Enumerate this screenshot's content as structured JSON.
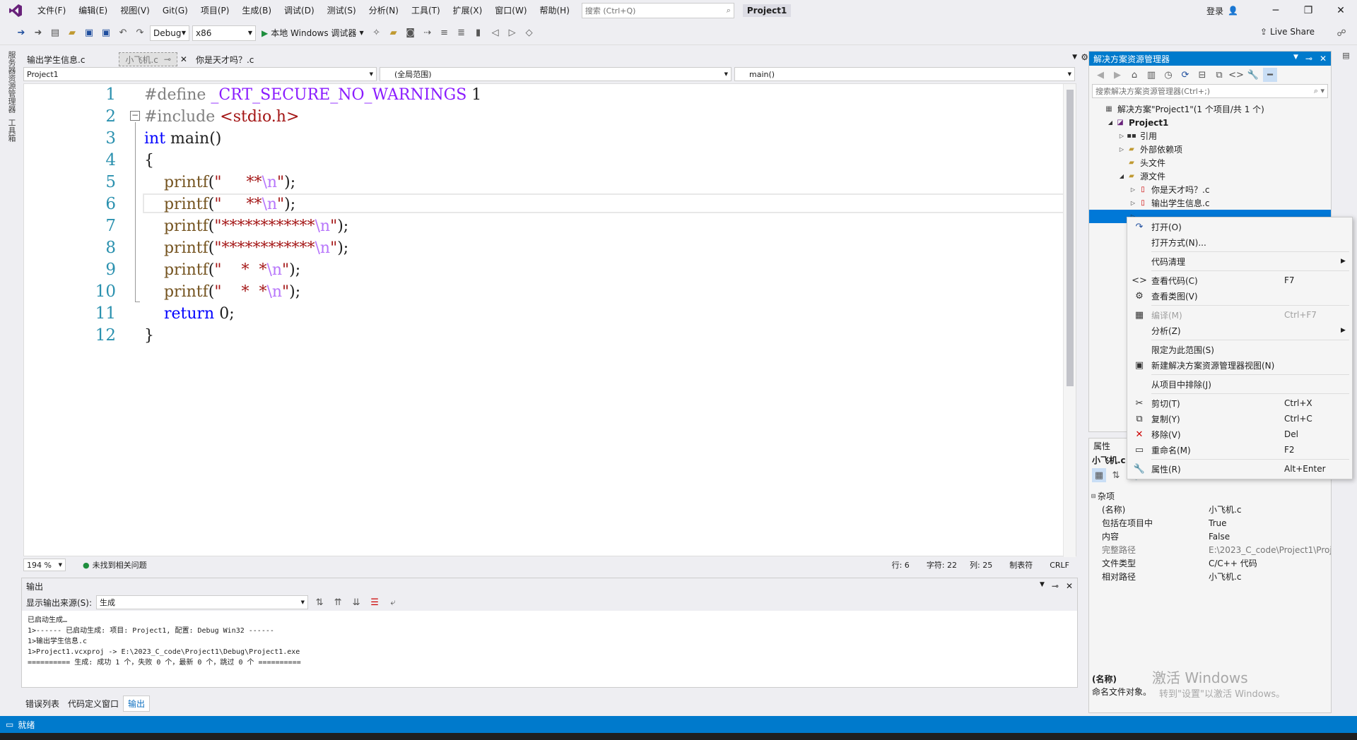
{
  "menubar": {
    "items": [
      "文件(F)",
      "编辑(E)",
      "视图(V)",
      "Git(G)",
      "项目(P)",
      "生成(B)",
      "调试(D)",
      "测试(S)",
      "分析(N)",
      "工具(T)",
      "扩展(X)",
      "窗口(W)",
      "帮助(H)"
    ],
    "search_placeholder": "搜索 (Ctrl+Q)",
    "project_title": "Project1",
    "login": "登录"
  },
  "toolbar": {
    "config": "Debug",
    "platform": "x86",
    "run_label": "本地 Windows 调试器",
    "live_share": "Live Share"
  },
  "left_strip": {
    "labels": [
      "服务器资源管理器",
      "工具箱"
    ]
  },
  "tabs": [
    {
      "label": "输出学生信息.c"
    },
    {
      "label": "小飞机.c"
    },
    {
      "label": "你是天才吗？.c"
    }
  ],
  "navbar": {
    "project": "Project1",
    "scope": "(全局范围)",
    "member": "main()"
  },
  "editor": {
    "line_numbers": [
      "1",
      "2",
      "3",
      "4",
      "5",
      "6",
      "7",
      "8",
      "9",
      "10",
      "11",
      "12"
    ],
    "lines": [
      {
        "a": "#define ",
        "b": "_CRT_SECURE_NO_WARNINGS",
        "c": " 1"
      },
      {
        "a": "#include ",
        "b": "<stdio.h>"
      },
      {
        "a": "int",
        "b": " main()"
      },
      {
        "a": "{"
      },
      {
        "a": "    printf",
        "b": "(",
        "c": "\"     **",
        "d": "\\n",
        "e": "\"",
        "f": ");"
      },
      {
        "a": "    printf",
        "b": "(",
        "c": "\"     **",
        "d": "\\n",
        "e": "\"",
        "f": ");"
      },
      {
        "a": "    printf",
        "b": "(",
        "c": "\"************",
        "d": "\\n",
        "e": "\"",
        "f": ");"
      },
      {
        "a": "    printf",
        "b": "(",
        "c": "\"************",
        "d": "\\n",
        "e": "\"",
        "f": ");"
      },
      {
        "a": "    printf",
        "b": "(",
        "c": "\"    *  *",
        "d": "\\n",
        "e": "\"",
        "f": ");"
      },
      {
        "a": "    printf",
        "b": "(",
        "c": "\"    *  *",
        "d": "\\n",
        "e": "\"",
        "f": ");"
      },
      {
        "a": "    return",
        "b": " 0;"
      },
      {
        "a": "}"
      }
    ]
  },
  "editor_status": {
    "zoom": "194 %",
    "issues": "未找到相关问题",
    "row": "行: 6",
    "char": "字符: 22",
    "col": "列: 25",
    "tab": "制表符",
    "eol": "CRLF"
  },
  "output": {
    "title": "输出",
    "source_label": "显示输出来源(S):",
    "source_value": "生成",
    "lines": [
      "已启动生成…",
      "1>------ 已启动生成: 项目: Project1, 配置: Debug Win32 ------",
      "1>输出学生信息.c",
      "1>Project1.vcxproj -> E:\\2023_C_code\\Project1\\Debug\\Project1.exe",
      "========== 生成: 成功 1 个，失败 0 个，最新 0 个，跳过 0 个 =========="
    ]
  },
  "bottom_tabs": [
    "错误列表",
    "代码定义窗口",
    "输出"
  ],
  "status": {
    "text": "就绪"
  },
  "solution_explorer": {
    "title": "解决方案资源管理器",
    "search_placeholder": "搜索解决方案资源管理器(Ctrl+;)",
    "nodes": [
      {
        "label": "解决方案\"Project1\"(1 个项目/共 1 个)",
        "indent": 0,
        "tri": ""
      },
      {
        "label": "Project1",
        "indent": 1,
        "tri": "◢",
        "bold": true
      },
      {
        "label": "引用",
        "indent": 2,
        "tri": "▷"
      },
      {
        "label": "外部依赖项",
        "indent": 2,
        "tri": "▷"
      },
      {
        "label": "头文件",
        "indent": 2,
        "tri": ""
      },
      {
        "label": "源文件",
        "indent": 2,
        "tri": "◢"
      },
      {
        "label": "你是天才吗？.c",
        "indent": 3,
        "tri": "▷"
      },
      {
        "label": "输出学生信息.c",
        "indent": 3,
        "tri": "▷"
      },
      {
        "label": "",
        "indent": 3,
        "tri": "▷",
        "selected": true
      }
    ]
  },
  "properties": {
    "title": "属性",
    "file": "小飞机.c",
    "category": "杂项",
    "rows": [
      {
        "name": "(名称)",
        "value": "小飞机.c"
      },
      {
        "name": "包括在项目中",
        "value": "True"
      },
      {
        "name": "内容",
        "value": "False"
      },
      {
        "name": "完整路径",
        "value": "E:\\2023_C_code\\Project1\\Proje"
      },
      {
        "name": "文件类型",
        "value": "C/C++ 代码"
      },
      {
        "name": "相对路径",
        "value": "小飞机.c"
      }
    ],
    "desc_title": "(名称)",
    "desc_text": "命名文件对象。"
  },
  "context_menu": {
    "items": [
      {
        "icon": "↷",
        "label": "打开(O)",
        "key": ""
      },
      {
        "icon": "",
        "label": "打开方式(N)...",
        "key": ""
      },
      {
        "sep": true
      },
      {
        "icon": "",
        "label": "代码清理",
        "key": "",
        "arrow": true
      },
      {
        "sep": true
      },
      {
        "icon": "<>",
        "label": "查看代码(C)",
        "key": "F7"
      },
      {
        "icon": "⚙",
        "label": "查看类图(V)",
        "key": ""
      },
      {
        "sep": true
      },
      {
        "icon": "▦",
        "label": "编译(M)",
        "key": "Ctrl+F7",
        "disabled": true
      },
      {
        "icon": "",
        "label": "分析(Z)",
        "key": "",
        "arrow": true
      },
      {
        "sep": true
      },
      {
        "icon": "",
        "label": "限定为此范围(S)",
        "key": ""
      },
      {
        "icon": "▣",
        "label": "新建解决方案资源管理器视图(N)",
        "key": ""
      },
      {
        "sep": true
      },
      {
        "icon": "",
        "label": "从项目中排除(J)",
        "key": ""
      },
      {
        "sep": true
      },
      {
        "icon": "✂",
        "label": "剪切(T)",
        "key": "Ctrl+X"
      },
      {
        "icon": "⧉",
        "label": "复制(Y)",
        "key": "Ctrl+C"
      },
      {
        "icon": "✕",
        "label": "移除(V)",
        "key": "Del"
      },
      {
        "icon": "▭",
        "label": "重命名(M)",
        "key": "F2"
      },
      {
        "sep": true
      },
      {
        "icon": "🔧",
        "label": "属性(R)",
        "key": "Alt+Enter"
      }
    ]
  },
  "watermark": {
    "line1": "激活 Windows",
    "line2": "转到\"设置\"以激活 Windows。"
  },
  "colors": {
    "accent": "#007acc",
    "selection": "#0078d7"
  }
}
